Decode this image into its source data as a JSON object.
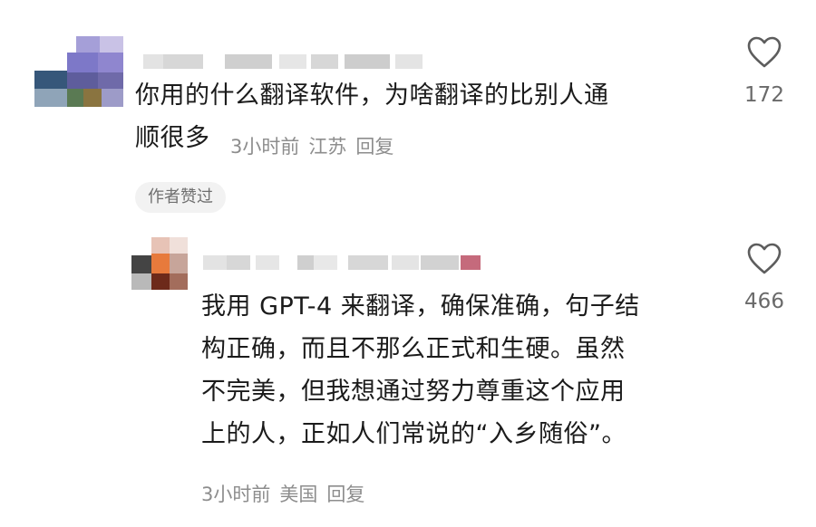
{
  "comments": [
    {
      "text_lines": [
        "你用的什么翻译软件，为啥翻译的比别人通",
        "顺很多"
      ],
      "time": "3小时前",
      "location": "江苏",
      "reply_label": "回复",
      "badge": "作者赞过",
      "likes": "172"
    },
    {
      "text_lines": [
        "我用 GPT-4 来翻译，确保准确，句子结",
        "构正确，而且不那么正式和生硬。虽然",
        "不完美，但我想通过努力尊重这个应用",
        "上的人，正如人们常说的“入乡随俗”。"
      ],
      "time": "3小时前",
      "location": "美国",
      "reply_label": "回复",
      "likes": "466"
    }
  ],
  "icons": {
    "like": "heart-outline-icon"
  }
}
